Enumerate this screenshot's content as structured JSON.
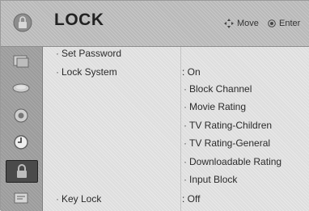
{
  "header": {
    "title": "LOCK",
    "move_hint": "Move",
    "enter_hint": "Enter"
  },
  "sidebar": {
    "items": [
      {
        "icon": "picture-icon"
      },
      {
        "icon": "audio-icon"
      },
      {
        "icon": "setup-icon"
      },
      {
        "icon": "time-icon"
      },
      {
        "icon": "lock-icon",
        "selected": true
      },
      {
        "icon": "option-icon"
      }
    ]
  },
  "menu": {
    "set_password": "Set Password",
    "lock_system": {
      "label": "Lock System",
      "value": ": On"
    },
    "sub_items": [
      "Block Channel",
      "Movie Rating",
      "TV Rating-Children",
      "TV Rating-General",
      "Downloadable Rating",
      "Input Block"
    ],
    "key_lock": {
      "label": "Key Lock",
      "value": ": Off"
    }
  }
}
